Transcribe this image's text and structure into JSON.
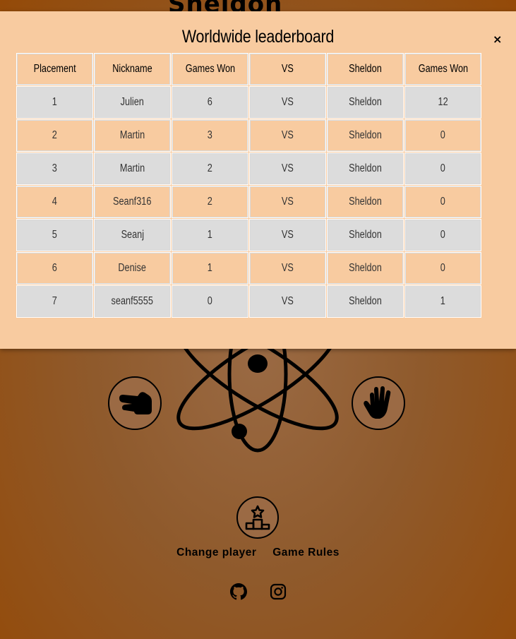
{
  "background": {
    "title": "Sheldon",
    "move_buttons": [
      {
        "name": "scissors",
        "icon": "hand-scissors-icon"
      },
      {
        "name": "spock",
        "icon": "hand-spock-icon"
      }
    ],
    "leaderboard_icon": "podium-star-icon",
    "links": {
      "change_player": "Change player",
      "game_rules": "Game Rules"
    },
    "social": [
      "github-icon",
      "instagram-icon"
    ]
  },
  "modal": {
    "title": "Worldwide leaderboard",
    "close_label": "×",
    "columns": [
      "Placement",
      "Nickname",
      "Games Won",
      "VS",
      "Sheldon",
      "Games Won"
    ],
    "rows": [
      [
        "1",
        "Julien",
        "6",
        "VS",
        "Sheldon",
        "12"
      ],
      [
        "2",
        "Martin",
        "3",
        "VS",
        "Sheldon",
        "0"
      ],
      [
        "3",
        "Martin",
        "2",
        "VS",
        "Sheldon",
        "0"
      ],
      [
        "4",
        "Seanf316",
        "2",
        "VS",
        "Sheldon",
        "0"
      ],
      [
        "5",
        "Seanj",
        "1",
        "VS",
        "Sheldon",
        "0"
      ],
      [
        "6",
        "Denise",
        "1",
        "VS",
        "Sheldon",
        "0"
      ],
      [
        "7",
        "seanf5555",
        "0",
        "VS",
        "Sheldon",
        "1"
      ]
    ]
  },
  "colors": {
    "modal_bg": "#f8cba0",
    "row_grey": "#dcdcdc",
    "page_bg": "#944a08"
  }
}
